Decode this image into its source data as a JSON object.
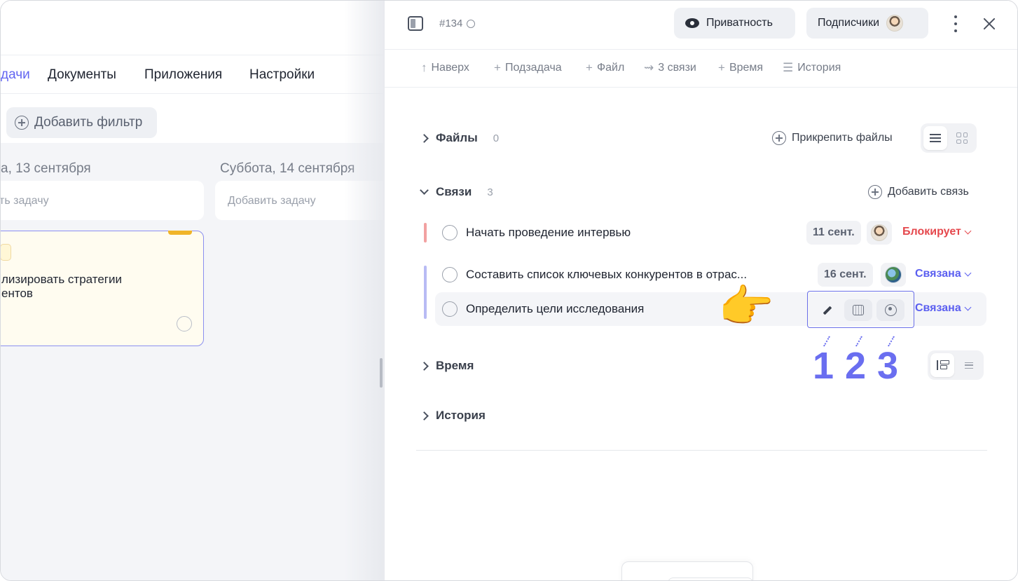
{
  "left": {
    "nav_tabs": [
      "дачи",
      "Документы",
      "Приложения",
      "Настройки"
    ],
    "add_filter_label": "Добавить фильтр",
    "days": [
      {
        "title": "а, 13 сентября",
        "add_task": "ть задачу"
      },
      {
        "title": "Суббота, 14 сентября",
        "add_task": "Добавить задачу"
      }
    ],
    "card": {
      "title": "лизировать стратегии\nентов"
    }
  },
  "panel": {
    "task_id": "#134",
    "privacy_label": "Приватность",
    "subscribers_label": "Подписчики",
    "toolbar": {
      "up": "Наверх",
      "subtask": "Подзадача",
      "file": "Файл",
      "links": "3 связи",
      "time": "Время",
      "history": "История",
      "up_glyph": "↑",
      "plus_glyph": "+",
      "links_glyph": "⇝",
      "history_glyph": "☰"
    },
    "files": {
      "label": "Файлы",
      "count": "0",
      "attach_label": "Прикрепить файлы"
    },
    "links": {
      "label": "Связи",
      "count": "3",
      "add_label": "Добавить связь",
      "items": [
        {
          "title": "Начать проведение интервью",
          "date": "11 сент.",
          "type": "Блокирует",
          "type_color": "#e5484d",
          "bar_color": "#f2a1a1"
        },
        {
          "title": "Составить список ключевых конкурентов в отрас...",
          "date": "16 сент.",
          "type": "Связана",
          "type_color": "#5b5ff0",
          "bar_color": "#b8bbf4"
        },
        {
          "title": "Определить цели исследования",
          "type": "Связана",
          "type_color": "#5b5ff0"
        }
      ]
    },
    "time": {
      "label": "Время"
    },
    "history": {
      "label": "История"
    },
    "callouts": [
      "1",
      "2",
      "3"
    ],
    "hand_emoji": "👉"
  }
}
